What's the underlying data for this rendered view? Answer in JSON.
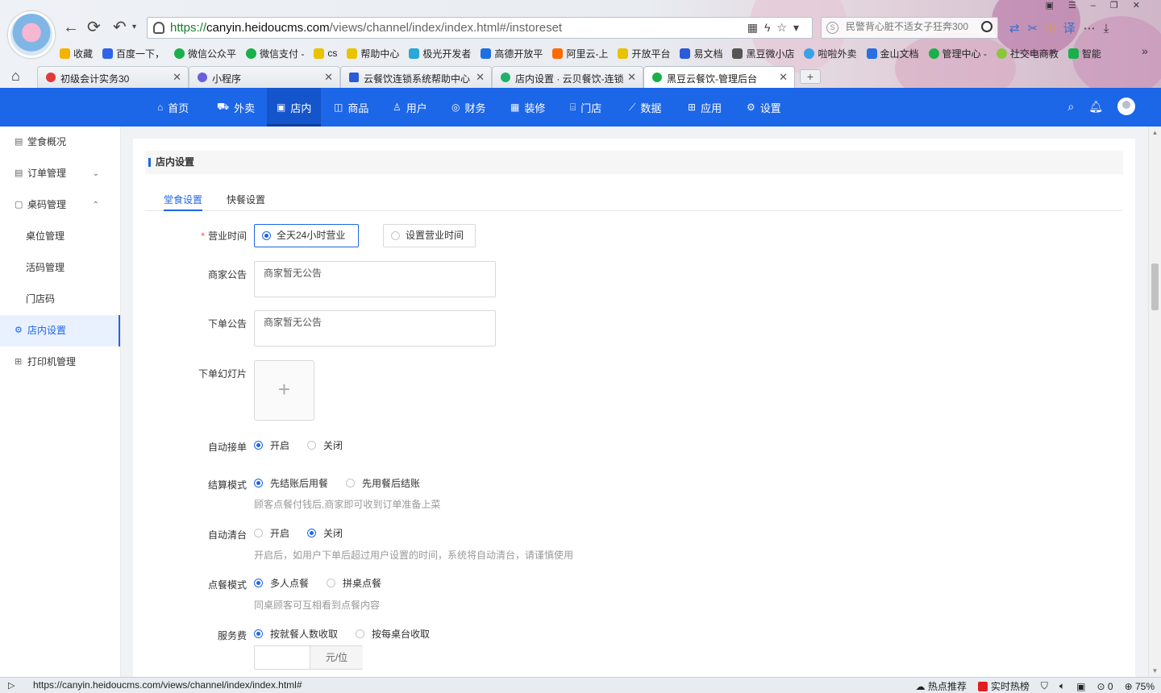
{
  "browser": {
    "url": "https://canyin.heidoucms.com/views/channel/index/index.html#/instoreset",
    "url_proto": "https://",
    "url_host": "canyin.heidoucms.com",
    "url_path": "/views/channel/index/index.html#/instoreset",
    "search_placeholder": "民警背心脏不适女子狂奔300",
    "bookmarks": [
      "收藏",
      "百度一下，",
      "微信公众平",
      "微信支付 -",
      "cs",
      "帮助中心",
      "极光开发者",
      "高德开放平",
      "阿里云-上",
      "开放平台",
      "易文档",
      "黑豆微小店",
      "啦啦外卖",
      "金山文档",
      "管理中心 -",
      "社交电商教",
      "智能"
    ],
    "tabs": [
      {
        "title": "初级会计实务30",
        "active": false
      },
      {
        "title": "小程序",
        "active": false
      },
      {
        "title": "云餐饮连锁系统帮助中心",
        "active": false
      },
      {
        "title": "店内设置 · 云贝餐饮-连锁",
        "active": false
      },
      {
        "title": "黑豆云餐饮-管理后台",
        "active": true
      }
    ],
    "status_url": "https://canyin.heidoucms.com/views/channel/index/index.html#",
    "status_hot": "热点推荐",
    "status_trend": "实时热榜",
    "status_count": "0",
    "zoom": "75%"
  },
  "topnav": {
    "items": [
      {
        "label": "首页",
        "icon": "⌂"
      },
      {
        "label": "外卖",
        "icon": "⛟"
      },
      {
        "label": "店内",
        "icon": "▣"
      },
      {
        "label": "商品",
        "icon": "◫"
      },
      {
        "label": "用户",
        "icon": "♙"
      },
      {
        "label": "财务",
        "icon": "◎"
      },
      {
        "label": "装修",
        "icon": "▦"
      },
      {
        "label": "门店",
        "icon": "⌸"
      },
      {
        "label": "数据",
        "icon": "⟋"
      },
      {
        "label": "应用",
        "icon": "⊞"
      },
      {
        "label": "设置",
        "icon": "⚙"
      }
    ],
    "active": "店内"
  },
  "sidebar": {
    "items": [
      {
        "label": "堂食概况",
        "icon": "▤"
      },
      {
        "label": "订单管理",
        "icon": "▤",
        "chevron": "⌄"
      },
      {
        "label": "桌码管理",
        "icon": "▢",
        "chevron": "⌃"
      },
      {
        "label": "桌位管理",
        "sub": true
      },
      {
        "label": "活码管理",
        "sub": true
      },
      {
        "label": "门店码",
        "sub": true
      },
      {
        "label": "店内设置",
        "icon": "⚙",
        "active": true
      },
      {
        "label": "打印机管理",
        "icon": "⊞"
      }
    ]
  },
  "page": {
    "title": "店内设置",
    "tabs": [
      "堂食设置",
      "快餐设置"
    ],
    "active_tab": "堂食设置"
  },
  "form": {
    "business_hours": {
      "label": "营业时间",
      "options": [
        "全天24小时营业",
        "设置营业时间"
      ],
      "selected": "全天24小时营业"
    },
    "notice": {
      "label": "商家公告",
      "value": "商家暂无公告"
    },
    "order_notice": {
      "label": "下单公告",
      "value": "商家暂无公告"
    },
    "slides": {
      "label": "下单幻灯片",
      "add": "+"
    },
    "auto_accept": {
      "label": "自动接单",
      "options": [
        "开启",
        "关闭"
      ],
      "selected": "开启"
    },
    "settle_mode": {
      "label": "结算模式",
      "options": [
        "先结账后用餐",
        "先用餐后结账"
      ],
      "selected": "先结账后用餐",
      "hint": "顾客点餐付钱后,商家即可收到订单准备上菜"
    },
    "auto_clear": {
      "label": "自动清台",
      "options": [
        "开启",
        "关闭"
      ],
      "selected": "关闭",
      "hint": "开启后，如用户下单后超过用户设置的时间，系统将自动清台，请谨慎使用"
    },
    "order_mode": {
      "label": "点餐模式",
      "options": [
        "多人点餐",
        "拼桌点餐"
      ],
      "selected": "多人点餐",
      "hint": "同桌顾客可互相看到点餐内容"
    },
    "service_fee": {
      "label": "服务费",
      "options": [
        "按就餐人数收取",
        "按每桌台收取"
      ],
      "selected": "按就餐人数收取",
      "value": "",
      "unit": "元/位"
    }
  }
}
